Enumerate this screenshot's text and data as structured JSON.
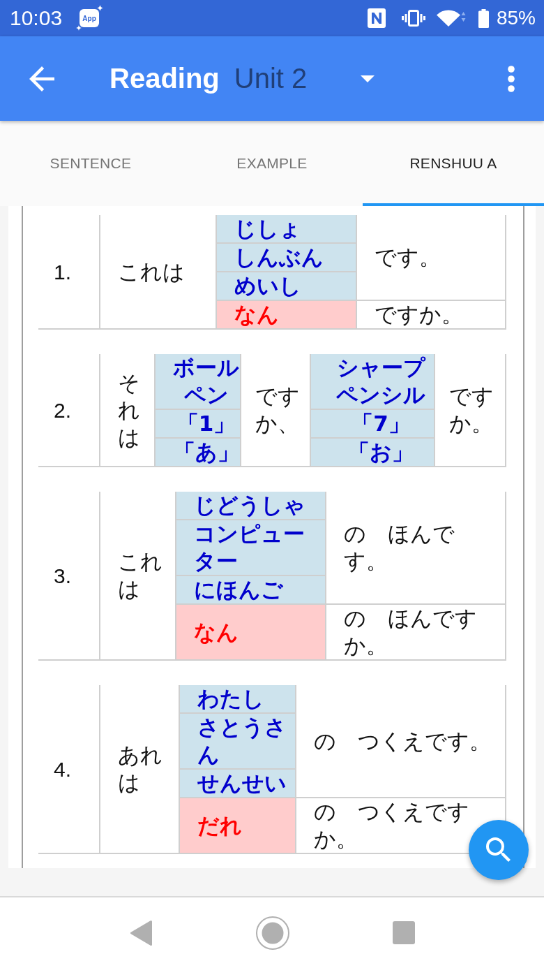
{
  "status_bar": {
    "time": "10:03",
    "notification_badge": "App",
    "battery": "85%"
  },
  "app_bar": {
    "title": "Reading",
    "unit_selector": "Unit 2"
  },
  "tabs": [
    {
      "label": "SENTENCE",
      "selected": false
    },
    {
      "label": "EXAMPLE",
      "selected": false
    },
    {
      "label": "RENSHUU A",
      "selected": true
    }
  ],
  "exercises": [
    {
      "kind": "single",
      "number": "1.",
      "subject": "これは",
      "choices": [
        "じしょ",
        "しんぶん",
        "めいし"
      ],
      "question_word": "なん",
      "statement_end": "です。",
      "question_end": "ですか。"
    },
    {
      "kind": "pair",
      "number": "2.",
      "subject": "それは",
      "groups": [
        {
          "choices": [
            "ボールペン",
            "「1」",
            "「あ」"
          ],
          "ending": "ですか、"
        },
        {
          "choices": [
            "シャープペンシル",
            "「7」",
            "「お」"
          ],
          "ending": "ですか。"
        }
      ]
    },
    {
      "kind": "single",
      "number": "3.",
      "subject": "これは",
      "choices": [
        "じどうしゃ",
        "コンピューター",
        "にほんご"
      ],
      "question_word": "なん",
      "statement_end": "の　ほんです。",
      "question_end": "の　ほんですか。"
    },
    {
      "kind": "single",
      "number": "4.",
      "subject": "あれは",
      "choices": [
        "わたし",
        "さとうさん",
        "せんせい"
      ],
      "question_word": "だれ",
      "statement_end": "の　つくえです。",
      "question_end": "の　つくえですか。"
    }
  ]
}
